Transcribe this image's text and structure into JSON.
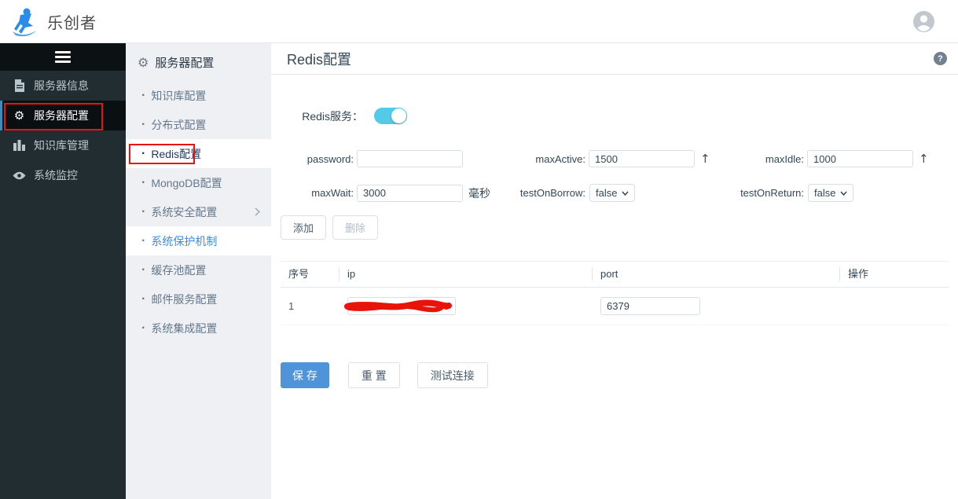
{
  "topbar": {
    "brand": "乐创者"
  },
  "sidebar": {
    "items": [
      {
        "label": "服务器信息"
      },
      {
        "label": "服务器配置"
      },
      {
        "label": "知识库管理"
      },
      {
        "label": "系统监控"
      }
    ]
  },
  "submenu": {
    "title": "服务器配置",
    "items": [
      {
        "label": "知识库配置"
      },
      {
        "label": "分布式配置"
      },
      {
        "label": "Redis配置"
      },
      {
        "label": "MongoDB配置"
      },
      {
        "label": "系统安全配置"
      },
      {
        "label": "系统保护机制"
      },
      {
        "label": "缓存池配置"
      },
      {
        "label": "邮件服务配置"
      },
      {
        "label": "系统集成配置"
      }
    ]
  },
  "main": {
    "title": "Redis配置",
    "help_icon": "?",
    "service_toggle": {
      "label": "Redis服务：",
      "state": "on"
    },
    "form": {
      "password": {
        "label": "password:",
        "value": ""
      },
      "maxActive": {
        "label": "maxActive:",
        "value": "1500"
      },
      "maxIdle": {
        "label": "maxIdle:",
        "value": "1000"
      },
      "maxWait": {
        "label": "maxWait:",
        "value": "3000",
        "unit": "毫秒"
      },
      "testOnBorrow": {
        "label": "testOnBorrow:",
        "value": "false"
      },
      "testOnReturn": {
        "label": "testOnReturn:",
        "value": "false"
      }
    },
    "actions": {
      "add": "添加",
      "delete": "删除"
    },
    "table": {
      "headers": [
        "序号",
        "ip",
        "port",
        "操作"
      ],
      "rows": [
        {
          "index": "1",
          "ip": "",
          "port": "6379"
        }
      ]
    },
    "footer_actions": {
      "save": "保 存",
      "reset": "重 置",
      "test": "测试连接"
    }
  },
  "colors": {
    "accent_blue": "#4f93d9",
    "toggle_blue": "#54c9ea",
    "sidebar_dark": "#222d32",
    "active_item_bar": "#3c8dbc",
    "annotation_red": "#e8130d",
    "hover_link_blue": "#3a8ee6"
  }
}
